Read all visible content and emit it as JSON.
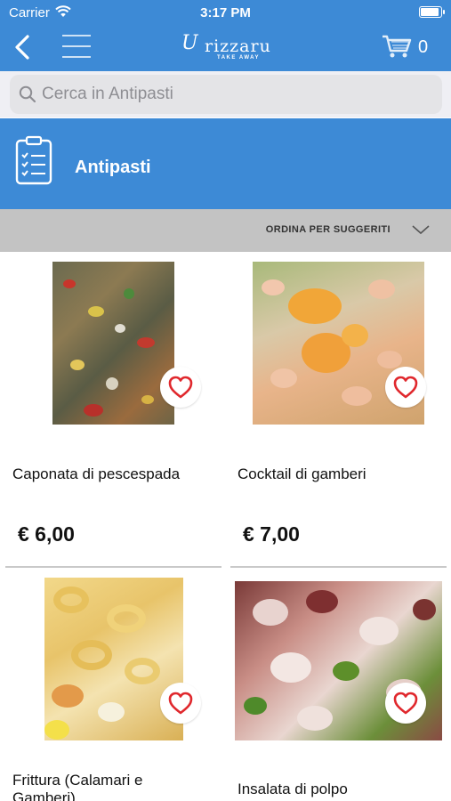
{
  "status": {
    "carrier": "Carrier",
    "time": "3:17 PM"
  },
  "header": {
    "logo_u": "U",
    "logo_name": "rizzaru",
    "logo_sub": "TAKE AWAY",
    "cart_count": "0",
    "accent": "#3d8ad6"
  },
  "search": {
    "placeholder": "Cerca in Antipasti",
    "value": ""
  },
  "category": {
    "title": "Antipasti",
    "icon": "clipboard-checklist-icon"
  },
  "sort": {
    "label": "ORDINA PER SUGGERITI",
    "icon": "chevron-down-icon"
  },
  "products": [
    {
      "name": "Caponata di pescespada",
      "price": "€ 6,00",
      "favorite": false,
      "icon": "heart-outline-icon"
    },
    {
      "name": "Cocktail di gamberi",
      "price": "€ 7,00",
      "favorite": false,
      "icon": "heart-outline-icon"
    },
    {
      "name": "Frittura (Calamari e Gamberi)",
      "price": "",
      "favorite": false,
      "icon": "heart-outline-icon"
    },
    {
      "name": "Insalata di polpo",
      "price": "",
      "favorite": false,
      "icon": "heart-outline-icon"
    }
  ],
  "colors": {
    "heart": "#e0282d",
    "sort_bar": "#c3c3c3"
  }
}
